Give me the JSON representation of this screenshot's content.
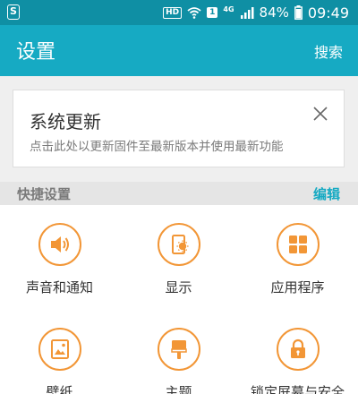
{
  "status_bar": {
    "hd_label": "HD",
    "sim_label": "1",
    "network_type": "4G",
    "battery_percent": "84%",
    "time": "09:49"
  },
  "app_bar": {
    "title": "设置",
    "search_label": "搜索"
  },
  "update_card": {
    "title": "系统更新",
    "description": "点击此处以更新固件至最新版本并使用最新功能"
  },
  "quick_settings": {
    "title": "快捷设置",
    "edit_label": "编辑",
    "items": [
      {
        "label": "声音和通知",
        "icon": "speaker-icon"
      },
      {
        "label": "显示",
        "icon": "display-icon"
      },
      {
        "label": "应用程序",
        "icon": "apps-grid-icon"
      },
      {
        "label": "壁纸",
        "icon": "wallpaper-icon"
      },
      {
        "label": "主题",
        "icon": "theme-brush-icon"
      },
      {
        "label": "锁定屏幕与安全",
        "icon": "lock-icon"
      }
    ]
  },
  "colors": {
    "status_bar": "#0f8fa4",
    "app_bar": "#16aac3",
    "accent_orange": "#f29636",
    "edit_link": "#16aac3"
  }
}
